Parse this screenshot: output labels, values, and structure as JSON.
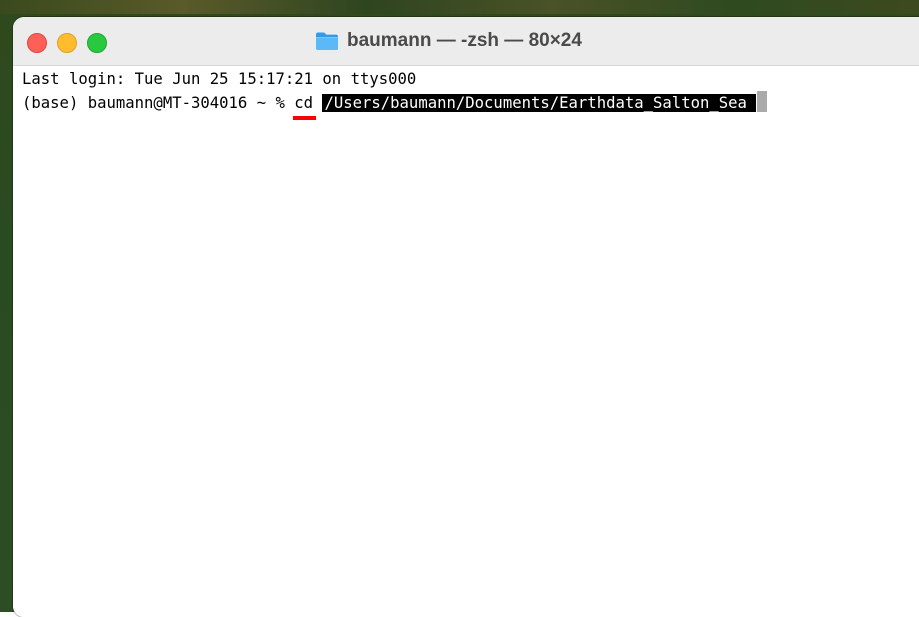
{
  "window": {
    "title": "baumann — -zsh — 80×24"
  },
  "terminal": {
    "last_login": "Last login: Tue Jun 25 15:17:21 on ttys000",
    "prompt": "(base) baumann@MT-304016 ~ % ",
    "command": "cd",
    "argument": "/Users/baumann/Documents/Earthdata_Salton_Sea "
  },
  "colors": {
    "close": "#fe5f57",
    "minimize": "#febc2e",
    "zoom": "#28c840",
    "annotation_underline": "#ff0000",
    "selection_background": "#000000"
  },
  "icons": {
    "title_icon": "folder-icon"
  }
}
